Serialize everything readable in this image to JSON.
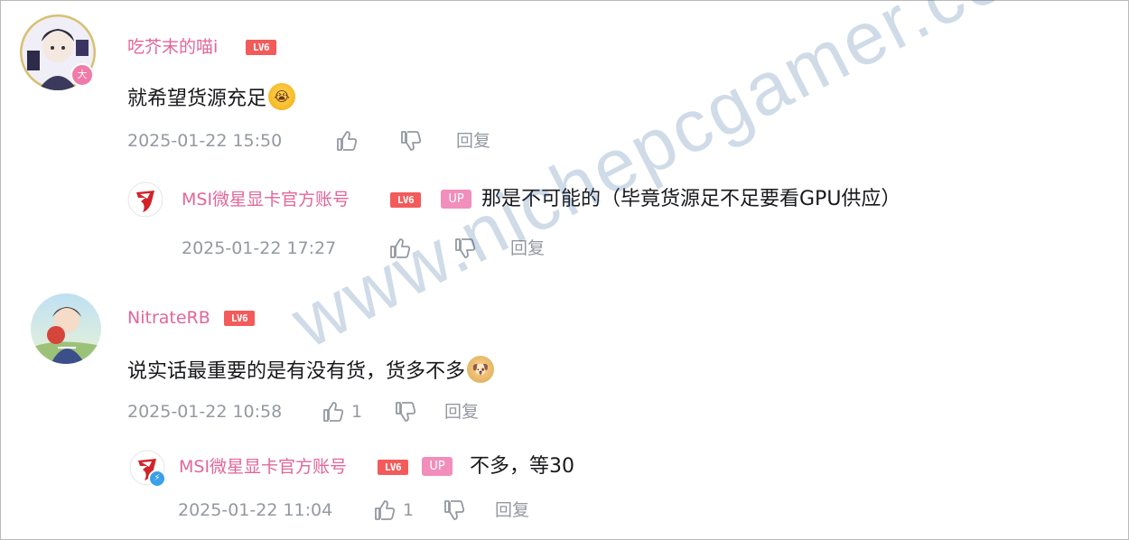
{
  "comments": [
    {
      "username": "吃芥末的喵i",
      "level": "LV6",
      "text": "就希望货源充足",
      "emoji": "crying-laughing-emoji",
      "timestamp": "2025-01-22 15:50",
      "like_count": "",
      "reply_label": "回复",
      "avatar_badge": "大",
      "reply": {
        "username": "MSI微星显卡官方账号",
        "level": "LV6",
        "up_badge": "UP",
        "text": "那是不可能的（毕竟货源足不足要看GPU供应）",
        "timestamp": "2025-01-22 17:27",
        "like_count": "",
        "reply_label": "回复"
      }
    },
    {
      "username": "NitrateRB",
      "level": "LV6",
      "text": "说实话最重要的是有没有货，货多不多",
      "emoji": "doge-emoji",
      "timestamp": "2025-01-22 10:58",
      "like_count": "1",
      "reply_label": "回复",
      "reply": {
        "username": "MSI微星显卡官方账号",
        "level": "LV6",
        "up_badge": "UP",
        "text": "不多，等30",
        "timestamp": "2025-01-22 11:04",
        "like_count": "1",
        "reply_label": "回复"
      }
    }
  ],
  "watermark": "www.nichepcgamer.com",
  "colors": {
    "username": "#e2669a",
    "level_badge": "#f35b5b",
    "up_badge": "#f18ebb",
    "meta": "#9499a0",
    "msi_red": "#d2232a"
  }
}
